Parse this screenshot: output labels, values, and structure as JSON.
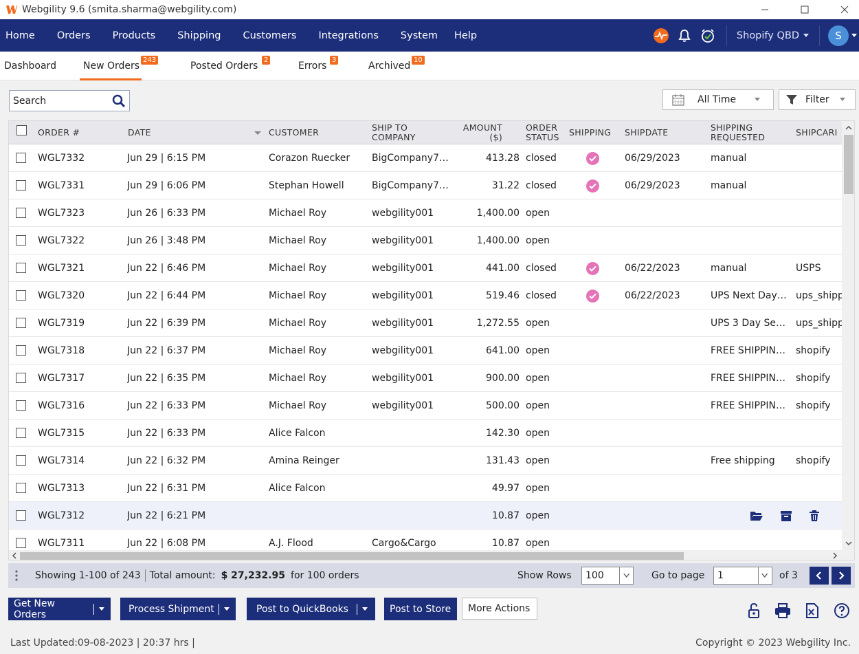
{
  "window": {
    "title": "Webgility 9.6 (smita.sharma@webgility.com)"
  },
  "menu": {
    "items": [
      "Home",
      "Orders",
      "Products",
      "Shipping",
      "Customers",
      "Integrations",
      "System",
      "Help"
    ],
    "store": "Shopify QBD",
    "avatar_initial": "S"
  },
  "tabs": [
    {
      "label": "Dashboard",
      "badge": ""
    },
    {
      "label": "New Orders",
      "badge": "243"
    },
    {
      "label": "Posted Orders",
      "badge": "2"
    },
    {
      "label": "Errors",
      "badge": "3"
    },
    {
      "label": "Archived",
      "badge": "10"
    }
  ],
  "toolbar": {
    "search_value": "Search",
    "date_filter": "All Time",
    "filter_label": "Filter"
  },
  "columns": {
    "order": "ORDER #",
    "date": "DATE",
    "customer": "CUSTOMER",
    "ship_to_1": "SHIP TO",
    "ship_to_2": "COMPANY",
    "amount_1": "AMOUNT",
    "amount_2": "($)",
    "status_1": "ORDER",
    "status_2": "STATUS",
    "shipping": "SHIPPING",
    "shipdate": "SHIPDATE",
    "ship_req_1": "SHIPPING",
    "ship_req_2": "REQUESTED",
    "shipcarrier": "SHIPCARI"
  },
  "orders": [
    {
      "order": "WGL7332",
      "date": "Jun 29 | 6:15 PM",
      "customer": "Corazon Ruecker",
      "company": "BigCompany7…",
      "amount": "413.28",
      "status": "closed",
      "shipped": true,
      "shipdate": "06/29/2023",
      "requested": "manual",
      "carrier": ""
    },
    {
      "order": "WGL7331",
      "date": "Jun 29 | 6:06 PM",
      "customer": "Stephan Howell",
      "company": "BigCompany7…",
      "amount": "31.22",
      "status": "closed",
      "shipped": true,
      "shipdate": "06/29/2023",
      "requested": "manual",
      "carrier": ""
    },
    {
      "order": "WGL7323",
      "date": "Jun 26 | 6:33 PM",
      "customer": "Michael Roy",
      "company": "webgility001",
      "amount": "1,400.00",
      "status": "open",
      "shipped": false,
      "shipdate": "",
      "requested": "",
      "carrier": ""
    },
    {
      "order": "WGL7322",
      "date": "Jun 26 | 3:48 PM",
      "customer": "Michael Roy",
      "company": "webgility001",
      "amount": "1,400.00",
      "status": "open",
      "shipped": false,
      "shipdate": "",
      "requested": "",
      "carrier": ""
    },
    {
      "order": "WGL7321",
      "date": "Jun 22 | 6:46 PM",
      "customer": "Michael Roy",
      "company": "webgility001",
      "amount": "441.00",
      "status": "closed",
      "shipped": true,
      "shipdate": "06/22/2023",
      "requested": "manual",
      "carrier": "USPS"
    },
    {
      "order": "WGL7320",
      "date": "Jun 22 | 6:44 PM",
      "customer": "Michael Roy",
      "company": "webgility001",
      "amount": "519.46",
      "status": "closed",
      "shipped": true,
      "shipdate": "06/22/2023",
      "requested": "UPS Next Day…",
      "carrier": "ups_shipp"
    },
    {
      "order": "WGL7319",
      "date": "Jun 22 | 6:39 PM",
      "customer": "Michael Roy",
      "company": "webgility001",
      "amount": "1,272.55",
      "status": "open",
      "shipped": false,
      "shipdate": "",
      "requested": "UPS 3 Day Se…",
      "carrier": "ups_shipp"
    },
    {
      "order": "WGL7318",
      "date": "Jun 22 | 6:37 PM",
      "customer": "Michael Roy",
      "company": "webgility001",
      "amount": "641.00",
      "status": "open",
      "shipped": false,
      "shipdate": "",
      "requested": "FREE SHIPPIN…",
      "carrier": "shopify"
    },
    {
      "order": "WGL7317",
      "date": "Jun 22 | 6:35 PM",
      "customer": "Michael Roy",
      "company": "webgility001",
      "amount": "900.00",
      "status": "open",
      "shipped": false,
      "shipdate": "",
      "requested": "FREE SHIPPIN…",
      "carrier": "shopify"
    },
    {
      "order": "WGL7316",
      "date": "Jun 22 | 6:33 PM",
      "customer": "Michael Roy",
      "company": "webgility001",
      "amount": "500.00",
      "status": "open",
      "shipped": false,
      "shipdate": "",
      "requested": "FREE SHIPPIN…",
      "carrier": "shopify"
    },
    {
      "order": "WGL7315",
      "date": "Jun 22 | 6:33 PM",
      "customer": "Alice Falcon",
      "company": "",
      "amount": "142.30",
      "status": "open",
      "shipped": false,
      "shipdate": "",
      "requested": "",
      "carrier": ""
    },
    {
      "order": "WGL7314",
      "date": "Jun 22 | 6:32 PM",
      "customer": "Amina Reinger",
      "company": "",
      "amount": "131.43",
      "status": "open",
      "shipped": false,
      "shipdate": "",
      "requested": "Free shipping",
      "carrier": "shopify"
    },
    {
      "order": "WGL7313",
      "date": "Jun 22 | 6:31 PM",
      "customer": "Alice Falcon",
      "company": "",
      "amount": "49.97",
      "status": "open",
      "shipped": false,
      "shipdate": "",
      "requested": "",
      "carrier": ""
    },
    {
      "order": "WGL7312",
      "date": "Jun 22 | 6:21 PM",
      "customer": "",
      "company": "",
      "amount": "10.87",
      "status": "open",
      "shipped": false,
      "shipdate": "",
      "requested": "",
      "carrier": ""
    },
    {
      "order": "WGL7311",
      "date": "Jun 22 | 6:08 PM",
      "customer": "A.J. Flood",
      "company": "Cargo&Cargo",
      "amount": "10.87",
      "status": "open",
      "shipped": false,
      "shipdate": "",
      "requested": "",
      "carrier": ""
    }
  ],
  "status": {
    "showing": "Showing 1-100 of 243",
    "total_label": "Total amount:",
    "total_value": "$ 27,232.95",
    "for_orders": "for 100 orders",
    "show_rows_label": "Show Rows",
    "show_rows_value": "100",
    "goto_label": "Go to page",
    "goto_value": "1",
    "of_pages": "of 3"
  },
  "actions": {
    "get_new_orders": "Get New Orders",
    "process_shipment": "Process Shipment",
    "post_quickbooks": "Post to QuickBooks",
    "post_store": "Post to Store",
    "more_actions": "More Actions"
  },
  "footer": {
    "last_updated": "Last Updated:09-08-2023 | 20:37 hrs |",
    "copyright": "Copyright © 2023 Webgility Inc."
  },
  "colors": {
    "navy": "#1c2d7a",
    "accent_orange": "#f26b1d",
    "ship_check_pink": "#e573b7"
  }
}
